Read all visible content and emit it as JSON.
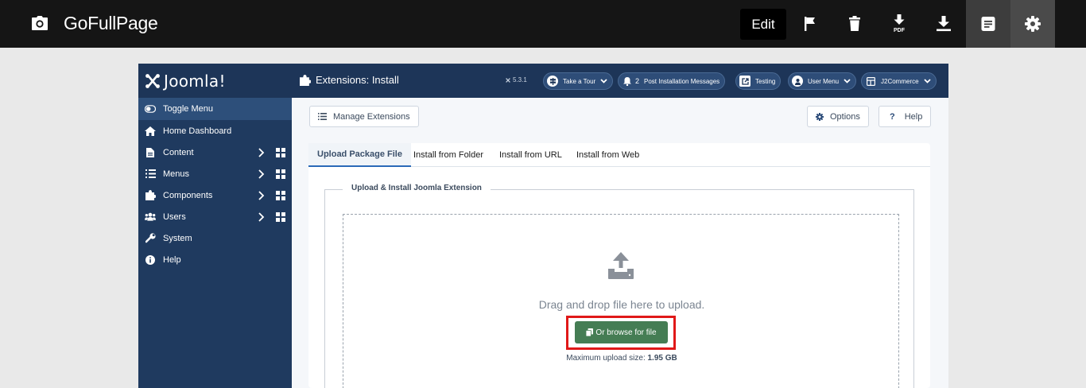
{
  "gofullpage": {
    "title": "GoFullPage",
    "edit_label": "Edit",
    "icons": [
      "camera-icon",
      "flag-icon",
      "trash-icon",
      "download-pdf-icon",
      "download-icon",
      "document-icon",
      "gear-icon"
    ],
    "pdf_label": "PDF"
  },
  "joomla": {
    "logo": "Joomla!",
    "header_title": "Extensions: Install",
    "version": "5.3.1",
    "pills": {
      "take_tour": "Take a Tour",
      "post_install_count": "2",
      "post_install": "Post Installation Messages",
      "testing": "Testing",
      "user_menu": "User Menu",
      "site": "J2Commerce"
    },
    "sidebar": {
      "items": [
        {
          "label": "Toggle Menu",
          "icon": "toggle-icon"
        },
        {
          "label": "Home Dashboard",
          "icon": "home-icon"
        },
        {
          "label": "Content",
          "icon": "file-icon",
          "has_sub": true
        },
        {
          "label": "Menus",
          "icon": "list-icon",
          "has_sub": true
        },
        {
          "label": "Components",
          "icon": "puzzle-icon",
          "has_sub": true
        },
        {
          "label": "Users",
          "icon": "users-icon",
          "has_sub": true
        },
        {
          "label": "System",
          "icon": "wrench-icon"
        },
        {
          "label": "Help",
          "icon": "info-icon"
        }
      ]
    },
    "toolbar": {
      "manage": "Manage Extensions",
      "options": "Options",
      "help": "Help"
    },
    "tabs": [
      {
        "label": "Upload Package File",
        "active": true
      },
      {
        "label": "Install from Folder"
      },
      {
        "label": "Install from URL"
      },
      {
        "label": "Install from Web"
      }
    ],
    "upload": {
      "legend": "Upload & Install Joomla Extension",
      "drop_text": "Drag and drop file here to upload.",
      "browse": "Or browse for file",
      "max_label": "Maximum upload size:",
      "max_value": "1.95 GB"
    },
    "colors": {
      "sidebar": "#1f3a5f",
      "header": "#1d3558",
      "browse_button": "#457d54",
      "highlight": "#e01818"
    }
  }
}
